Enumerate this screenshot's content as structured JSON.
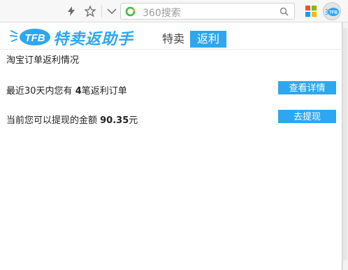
{
  "toolbar": {
    "icons": [
      "lightning-icon",
      "star-icon",
      "chevron-down-icon"
    ],
    "search": {
      "placeholder": "360搜索",
      "logo": "360-search-logo-icon",
      "button_icon": "search-icon"
    },
    "ms_icon": "windows-logo-icon",
    "extension_icon": "tfb-extension-icon",
    "extension_badge": "TFB"
  },
  "header": {
    "logo_text": "TFB",
    "brand": "特卖返助手",
    "tabs": [
      {
        "label": "特卖",
        "active": false
      },
      {
        "label": "返利",
        "active": true
      }
    ],
    "brand_color": "#2da7ef"
  },
  "content": {
    "section_title": "淘宝订单返利情况",
    "orders_prefix": "最近30天内您有 ",
    "orders_count": "4",
    "orders_suffix": "笔返利订单",
    "orders_button": "查看详情",
    "balance_prefix": "当前您可以提现的金额 ",
    "balance_amount": "90.35",
    "balance_suffix": "元",
    "balance_button": "去提现"
  }
}
